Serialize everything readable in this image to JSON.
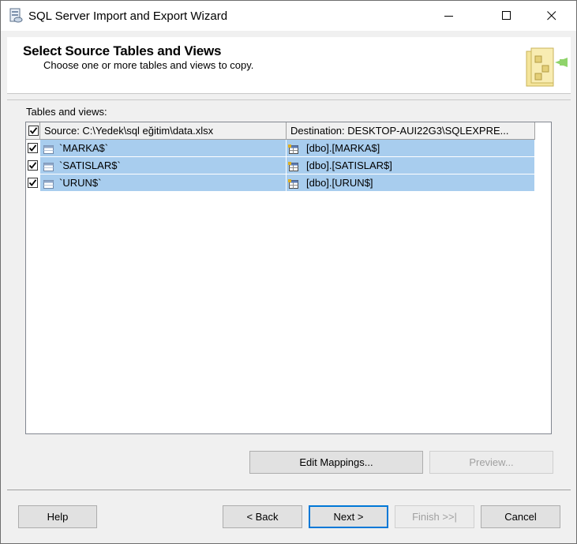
{
  "window": {
    "title": "SQL Server Import and Export Wizard",
    "icon": "wizard-app-icon",
    "controls": [
      "minimize-icon",
      "maximize-icon",
      "close-icon"
    ]
  },
  "header": {
    "title": "Select Source Tables and Views",
    "subtitle": "Choose one or more tables and views to copy.",
    "icon": "wizard-folder-icon"
  },
  "tables": {
    "label": "Tables and views:",
    "columns": {
      "source": "Source: C:\\Yedek\\sql eğitim\\data.xlsx",
      "destination": "Destination: DESKTOP-AUI22G3\\SQLEXPRE..."
    },
    "select_all_checked": true,
    "rows": [
      {
        "checked": true,
        "source": "`MARKA$`",
        "destination": "[dbo].[MARKA$]"
      },
      {
        "checked": true,
        "source": "`SATISLAR$`",
        "destination": "[dbo].[SATISLAR$]"
      },
      {
        "checked": true,
        "source": "`URUN$`",
        "destination": "[dbo].[URUN$]"
      }
    ]
  },
  "actions": {
    "edit_mappings": "Edit Mappings...",
    "preview": "Preview..."
  },
  "footer": {
    "help": "Help",
    "back": "< Back",
    "next": "Next >",
    "finish": "Finish >>|",
    "cancel": "Cancel"
  },
  "colors": {
    "selection": "#a8cdee",
    "default_button_border": "#0078d7"
  }
}
